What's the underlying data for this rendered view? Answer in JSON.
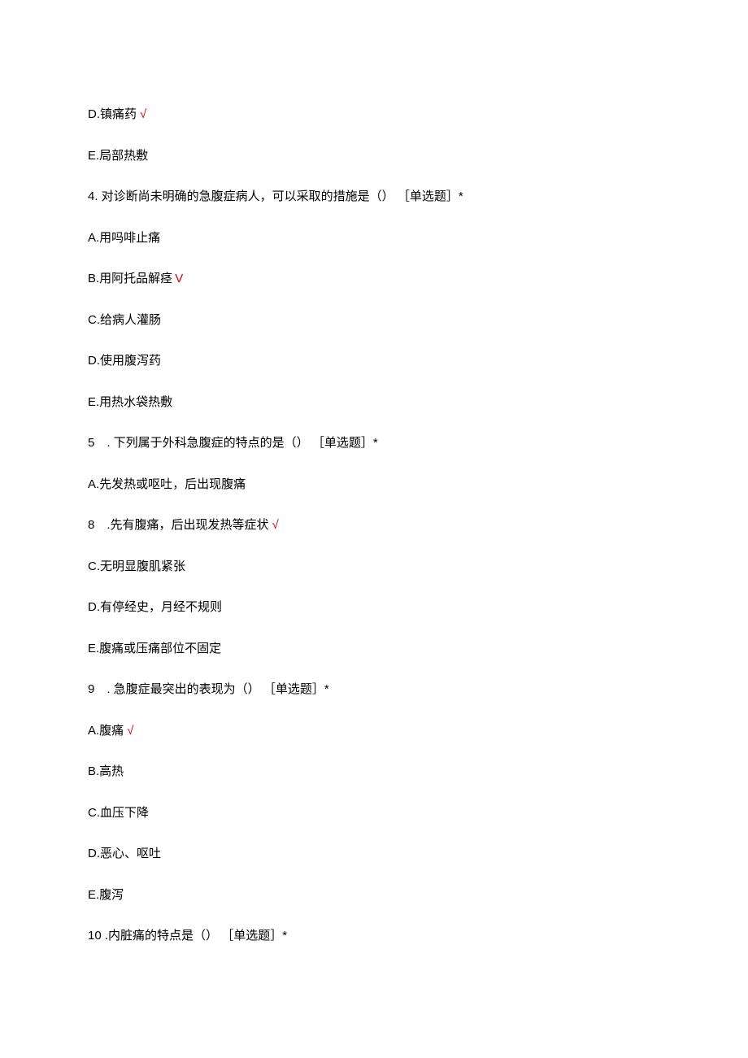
{
  "lines": [
    {
      "text": "D.镇痛药",
      "mark": "√"
    },
    {
      "text": "E.局部热敷",
      "mark": ""
    },
    {
      "text": "4. 对诊断尚未明确的急腹症病人，可以采取的措施是（） ［单选题］*",
      "mark": ""
    },
    {
      "text": "A.用吗啡止痛",
      "mark": ""
    },
    {
      "text": "B.用阿托品解痉",
      "mark": "V"
    },
    {
      "text": "C.给病人灌肠",
      "mark": ""
    },
    {
      "text": "D.使用腹泻药",
      "mark": ""
    },
    {
      "text": "E.用热水袋热敷",
      "mark": ""
    },
    {
      "text": "5　. 下列属于外科急腹症的特点的是（） ［单选题］*",
      "mark": ""
    },
    {
      "text": "A.先发热或呕吐，后出现腹痛",
      "mark": ""
    },
    {
      "text": "8　.先有腹痛，后出现发热等症状",
      "mark": "√"
    },
    {
      "text": "C.无明显腹肌紧张",
      "mark": ""
    },
    {
      "text": "D.有停经史，月经不规则",
      "mark": ""
    },
    {
      "text": "E.腹痛或压痛部位不固定",
      "mark": ""
    },
    {
      "text": "9　. 急腹症最突出的表现为（） ［单选题］*",
      "mark": ""
    },
    {
      "text": "A.腹痛",
      "mark": "√"
    },
    {
      "text": "B.高热",
      "mark": ""
    },
    {
      "text": "C.血压下降",
      "mark": ""
    },
    {
      "text": "D.恶心、呕吐",
      "mark": ""
    },
    {
      "text": "E.腹泻",
      "mark": ""
    },
    {
      "text": "10 .内脏痛的特点是（） ［单选题］*",
      "mark": ""
    }
  ]
}
